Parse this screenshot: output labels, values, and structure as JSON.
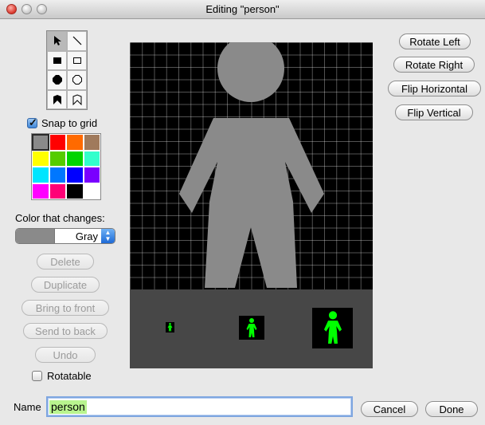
{
  "window": {
    "title": "Editing \"person\""
  },
  "tools": [
    {
      "name": "select-arrow-icon",
      "selected": true
    },
    {
      "name": "line-icon",
      "selected": false
    },
    {
      "name": "filled-rect-icon",
      "selected": false
    },
    {
      "name": "rect-outline-icon",
      "selected": false
    },
    {
      "name": "filled-octagon-icon",
      "selected": false
    },
    {
      "name": "octagon-outline-icon",
      "selected": false
    },
    {
      "name": "filled-polygon-icon",
      "selected": false
    },
    {
      "name": "polygon-outline-icon",
      "selected": false
    }
  ],
  "snap_label": "Snap to grid",
  "snap_checked": true,
  "palette": [
    "#8a8a8a",
    "#ff0000",
    "#ff6a00",
    "#a07a5c",
    "#ffff00",
    "#55cc00",
    "#00d400",
    "#33ffcc",
    "#00e5ff",
    "#0077ff",
    "#0000ff",
    "#7a00ff",
    "#ff00ff",
    "#ff0077",
    "#000000",
    "#ffffff"
  ],
  "color_changes_label": "Color that changes:",
  "color_select": {
    "value": "Gray",
    "color": "#8a8a8a"
  },
  "buttons": {
    "delete": "Delete",
    "duplicate": "Duplicate",
    "bring_front": "Bring to front",
    "send_back": "Send to back",
    "undo": "Undo",
    "rotate_left": "Rotate Left",
    "rotate_right": "Rotate Right",
    "flip_h": "Flip Horizontal",
    "flip_v": "Flip Vertical",
    "cancel": "Cancel",
    "done": "Done"
  },
  "rotatable_label": "Rotatable",
  "rotatable_checked": false,
  "name_label": "Name",
  "name_value": "person",
  "figure_color": "#8a8a8a",
  "preview_color": "#00ff00"
}
